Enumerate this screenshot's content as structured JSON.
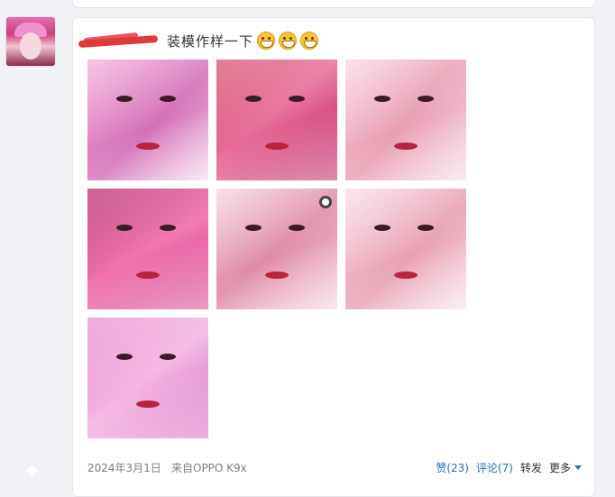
{
  "post": {
    "username": "",
    "text": "装模作样一下",
    "emojis": [
      "grin-emoji",
      "grin-emoji",
      "grin-emoji"
    ],
    "photos_count": 7,
    "date": "2024年3月1日",
    "source": "来自OPPO K9x"
  },
  "actions": {
    "like": "赞(23)",
    "comment": "评论(7)",
    "forward": "转发",
    "more": "更多"
  },
  "colors": {
    "link": "#2a6ec7",
    "meta": "#808080",
    "redaction": "#e0393a"
  }
}
